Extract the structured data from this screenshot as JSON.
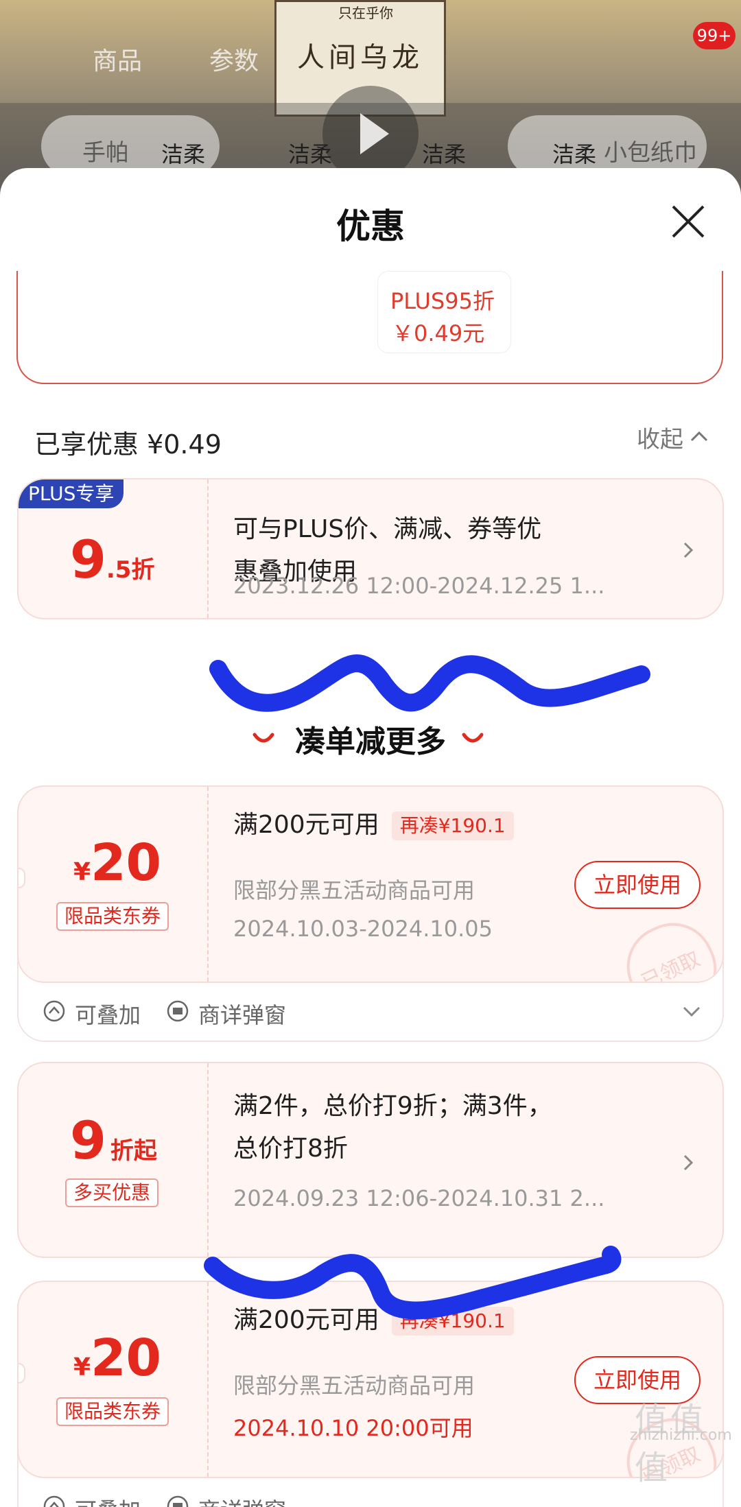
{
  "background": {
    "tabs": [
      "商品",
      "参数"
    ],
    "poster_title": "人间乌龙",
    "poster_sub": "只在乎你",
    "brand": "洁柔",
    "search_text": "手帕",
    "search_text2": "小包纸巾",
    "badge": "99+"
  },
  "sheet": {
    "title": "优惠",
    "close_icon": "close-icon"
  },
  "top_offer": {
    "line1": "PLUS95折",
    "line2": "￥0.49元"
  },
  "enjoyed": {
    "label": "已享优惠 ¥0.49",
    "collapse": "收起"
  },
  "plus_card": {
    "tag": "PLUS专享",
    "big": "9",
    "small": ".5折",
    "desc_line1": "可与PLUS价、满减、券等优",
    "desc_line2": "惠叠加使用",
    "date": "2023.12.26 12:00-2024.12.25 1..."
  },
  "more": {
    "title": "凑单减更多"
  },
  "coupon1": {
    "currency": "¥",
    "amount": "20",
    "tag": "限品类东券",
    "title": "满200元可用",
    "chip": "再凑¥190.1",
    "desc": "限部分黑五活动商品可用",
    "date": "2024.10.03-2024.10.05",
    "button": "立即使用",
    "stamp": "已领取",
    "foot1": "可叠加",
    "foot2": "商详弹窗"
  },
  "discount_card": {
    "big": "9",
    "small": "折起",
    "tag": "多买优惠",
    "desc_line1": "满2件，总价打9折；满3件，",
    "desc_line2": "总价打8折",
    "date": "2024.09.23 12:06-2024.10.31 2..."
  },
  "coupon2": {
    "currency": "¥",
    "amount": "20",
    "tag": "限品类东券",
    "title": "满200元可用",
    "chip": "再凑¥190.1",
    "desc": "限部分黑五活动商品可用",
    "date": "2024.10.10 20:00可用",
    "button": "立即使用",
    "stamp": "已领取",
    "foot1": "可叠加",
    "foot2": "商详弹窗"
  },
  "watermark": {
    "big": "值值值",
    "small": "zhizhizhi.com"
  },
  "colors": {
    "accent_red": "#e3281d",
    "plus_blue": "#2d44b5",
    "card_bg": "#fff5f3",
    "scribble_blue": "#1e32e6"
  }
}
